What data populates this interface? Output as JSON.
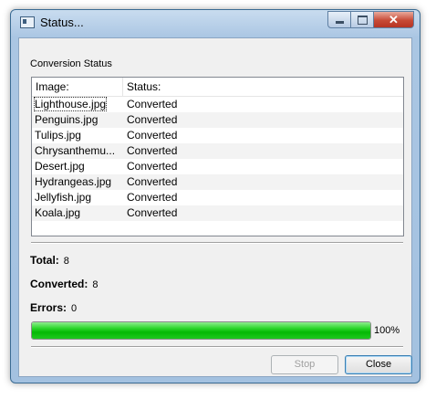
{
  "window": {
    "title": "Status..."
  },
  "section_label": "Conversion Status",
  "list": {
    "columns": [
      "Image:",
      "Status:"
    ],
    "rows": [
      {
        "image": "Lighthouse.jpg",
        "status": "Converted"
      },
      {
        "image": "Penguins.jpg",
        "status": "Converted"
      },
      {
        "image": "Tulips.jpg",
        "status": "Converted"
      },
      {
        "image": "Chrysanthemu...",
        "status": "Converted"
      },
      {
        "image": "Desert.jpg",
        "status": "Converted"
      },
      {
        "image": "Hydrangeas.jpg",
        "status": "Converted"
      },
      {
        "image": "Jellyfish.jpg",
        "status": "Converted"
      },
      {
        "image": "Koala.jpg",
        "status": "Converted"
      }
    ]
  },
  "stats": {
    "total_label": "Total:",
    "total_value": "8",
    "converted_label": "Converted:",
    "converted_value": "8",
    "errors_label": "Errors:",
    "errors_value": "0"
  },
  "progress": {
    "percent": 100,
    "label": "100%"
  },
  "buttons": {
    "stop": "Stop",
    "close": "Close"
  },
  "colors": {
    "progress_green": "#06b806",
    "title_bar": "#aac6e3"
  },
  "caption": {
    "close_glyph": "✕"
  }
}
